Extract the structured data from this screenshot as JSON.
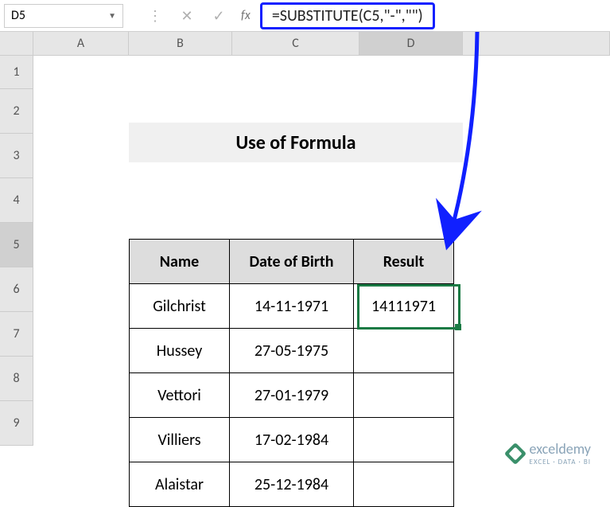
{
  "nameBox": "D5",
  "formula": "=SUBSTITUTE(C5,\"-\",\"\")",
  "columns": [
    "A",
    "B",
    "C",
    "D"
  ],
  "selectedCol": "D",
  "rows": [
    "1",
    "2",
    "3",
    "4",
    "5",
    "6",
    "7",
    "8",
    "9"
  ],
  "selectedRow": "5",
  "title": "Use of Formula",
  "tableHeaders": {
    "name": "Name",
    "dob": "Date of Birth",
    "result": "Result"
  },
  "tableRows": [
    {
      "name": "Gilchrist",
      "dob": "14-11-1971",
      "result": "14111971"
    },
    {
      "name": "Hussey",
      "dob": "27-05-1975",
      "result": ""
    },
    {
      "name": "Vettori",
      "dob": "27-01-1979",
      "result": ""
    },
    {
      "name": "Villiers",
      "dob": "17-02-1984",
      "result": ""
    },
    {
      "name": "Alaistar",
      "dob": "25-12-1984",
      "result": ""
    }
  ],
  "logo": {
    "brand": "exceldemy",
    "tagline": "EXCEL · DATA · BI"
  }
}
